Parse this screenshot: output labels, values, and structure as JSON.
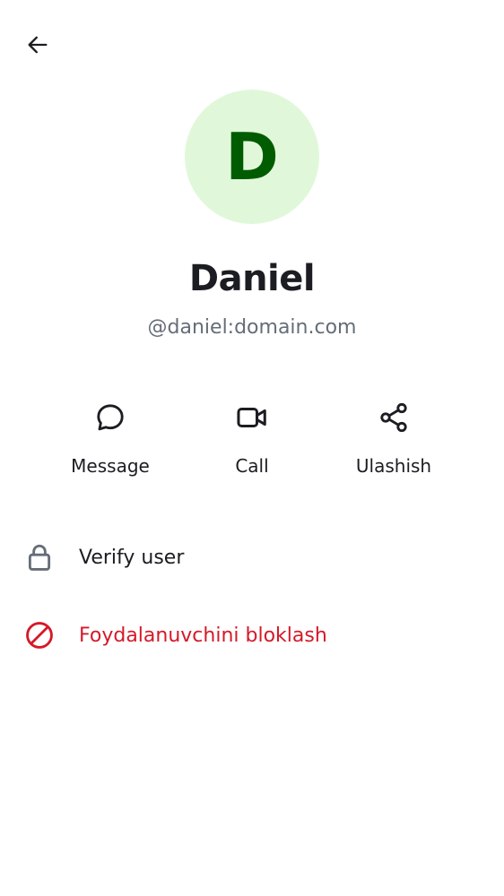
{
  "header": {
    "back_icon": "arrow-left-icon"
  },
  "profile": {
    "avatar_initial": "D",
    "display_name": "Daniel",
    "user_id": "@daniel:domain.com",
    "avatar_bg": "#e0f8d9",
    "avatar_fg": "#005c00"
  },
  "actions": [
    {
      "label": "Message",
      "icon": "chat-bubble-icon"
    },
    {
      "label": "Call",
      "icon": "video-camera-icon"
    },
    {
      "label": "Ulashish",
      "icon": "share-icon"
    }
  ],
  "options": [
    {
      "label": "Verify user",
      "icon": "lock-icon",
      "color": "#1b1d22"
    },
    {
      "label": "Foydalanuvchini bloklash",
      "icon": "block-icon",
      "color": "#d51928"
    }
  ]
}
